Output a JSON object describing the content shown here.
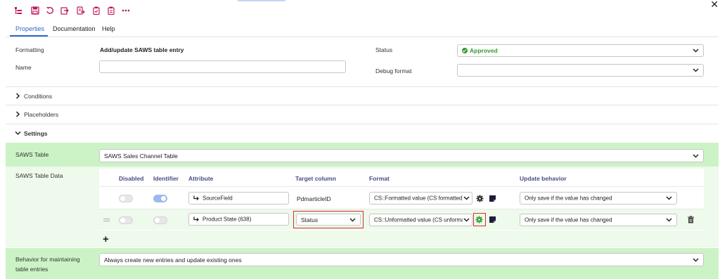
{
  "toolbar": {
    "icons": [
      "tree-structure-icon",
      "save-icon",
      "undo-icon",
      "export-icon",
      "database-export-icon",
      "clipboard-check-icon",
      "clipboard-paste-icon",
      "more-icon"
    ],
    "icon_color": "#c0175d",
    "close_label": "✕"
  },
  "tabs": [
    {
      "label": "Properties",
      "active": true
    },
    {
      "label": "Documentation",
      "active": false
    },
    {
      "label": "Help",
      "active": false
    }
  ],
  "general": {
    "formatting_label": "Formatting",
    "formatting_value": "Add/update SAWS table entry",
    "name_label": "Name",
    "name_value": "",
    "status_label": "Status",
    "status_value": "Approved",
    "status_color": "#2f9a2f",
    "debug_label": "Debug format",
    "debug_value": ""
  },
  "sections": {
    "conditions": "Conditions",
    "placeholders": "Placeholders",
    "settings": "Settings"
  },
  "settings": {
    "saws_table_label": "SAWS Table",
    "saws_table_value": "SAWS Sales Channel Table",
    "saws_table_data_label": "SAWS Table Data",
    "behavior_label_line1": "Behavior for maintaining",
    "behavior_label_line2": "table entries",
    "behavior_value": "Always create new entries and update existing ones",
    "highlight_color": "#ccf3c6"
  },
  "table": {
    "headers": {
      "disabled": "Disabled",
      "identifier": "Identifier",
      "attribute": "Attribute",
      "target_column": "Target column",
      "format": "Format",
      "update_behavior": "Update behavior"
    },
    "rows": [
      {
        "disabled": false,
        "identifier": true,
        "attribute": "SourceField",
        "target_column": "PdmarticleID",
        "format": "CS::Formatted value (CS formatted)",
        "update_behavior": "Only save if the value has changed"
      },
      {
        "disabled": false,
        "identifier": false,
        "attribute": "Product State (638)",
        "target_column": "Status",
        "format": "CS::Unformatted value (CS unformatted)",
        "update_behavior": "Only save if the value has changed"
      }
    ],
    "add_label": "+"
  }
}
